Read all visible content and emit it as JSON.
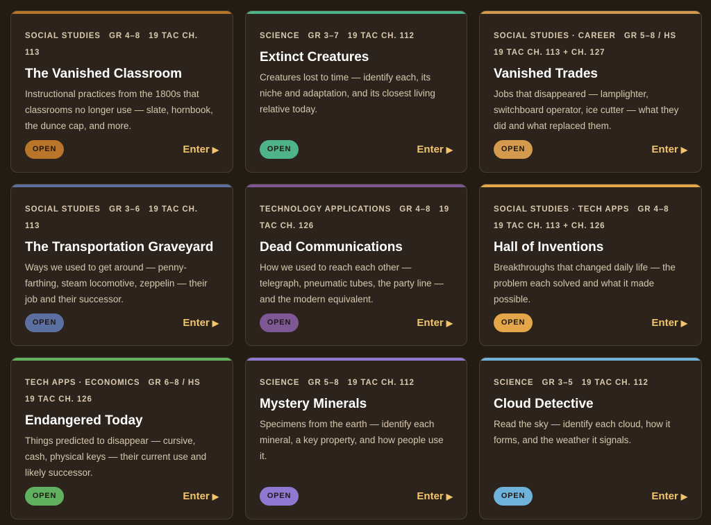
{
  "cards": [
    {
      "tags": [
        "SOCIAL STUDIES",
        "GR 4–8",
        "19 TAC CH. 113"
      ],
      "title": "The Vanished Classroom",
      "description": "Instructional practices from the 1800s that classrooms no longer use — slate, hornbook, the dunce cap, and more.",
      "status": "OPEN",
      "cta": "Enter",
      "accent": "#b9752a"
    },
    {
      "tags": [
        "SCIENCE",
        "GR 3–7",
        "19 TAC CH. 112"
      ],
      "title": "Extinct Creatures",
      "description": "Creatures lost to time — identify each, its niche and adaptation, and its closest living relative today.",
      "status": "OPEN",
      "cta": "Enter",
      "accent": "#4fb38a"
    },
    {
      "tags": [
        "SOCIAL STUDIES · CAREER",
        "GR 5–8 / HS",
        "19 TAC CH. 113 + CH. 127"
      ],
      "title": "Vanished Trades",
      "description": "Jobs that disappeared — lamplighter, switchboard operator, ice cutter — what they did and what replaced them.",
      "status": "OPEN",
      "cta": "Enter",
      "accent": "#d49a4e"
    },
    {
      "tags": [
        "SOCIAL STUDIES",
        "GR 3–6",
        "19 TAC CH. 113"
      ],
      "title": "The Transportation Graveyard",
      "description": "Ways we used to get around — penny-farthing, steam locomotive, zeppelin — their job and their successor.",
      "status": "OPEN",
      "cta": "Enter",
      "accent": "#5b6fa0"
    },
    {
      "tags": [
        "TECHNOLOGY APPLICATIONS",
        "GR 4–8",
        "19 TAC CH. 126"
      ],
      "title": "Dead Communications",
      "description": "How we used to reach each other — telegraph, pneumatic tubes, the party line — and the modern equivalent.",
      "status": "OPEN",
      "cta": "Enter",
      "accent": "#7e5795"
    },
    {
      "tags": [
        "SOCIAL STUDIES · TECH APPS",
        "GR 4–8",
        "19 TAC CH. 113 + CH. 126"
      ],
      "title": "Hall of Inventions",
      "description": "Breakthroughs that changed daily life — the problem each solved and what it made possible.",
      "status": "OPEN",
      "cta": "Enter",
      "accent": "#e3a74a"
    },
    {
      "tags": [
        "TECH APPS · ECONOMICS",
        "GR 6–8 / HS",
        "19 TAC CH. 126"
      ],
      "title": "Endangered Today",
      "description": "Things predicted to disappear — cursive, cash, physical keys — their current use and likely successor.",
      "status": "OPEN",
      "cta": "Enter",
      "accent": "#5fb05f"
    },
    {
      "tags": [
        "SCIENCE",
        "GR 5–8",
        "19 TAC CH. 112"
      ],
      "title": "Mystery Minerals",
      "description": "Specimens from the earth — identify each mineral, a key property, and how people use it.",
      "status": "OPEN",
      "cta": "Enter",
      "accent": "#8d79d2"
    },
    {
      "tags": [
        "SCIENCE",
        "GR 3–5",
        "19 TAC CH. 112"
      ],
      "title": "Cloud Detective",
      "description": "Read the sky — identify each cloud, how it forms, and the weather it signals.",
      "status": "OPEN",
      "cta": "Enter",
      "accent": "#6fb2da"
    }
  ],
  "icons": {
    "enter_arrow": "play-arrow-icon"
  }
}
